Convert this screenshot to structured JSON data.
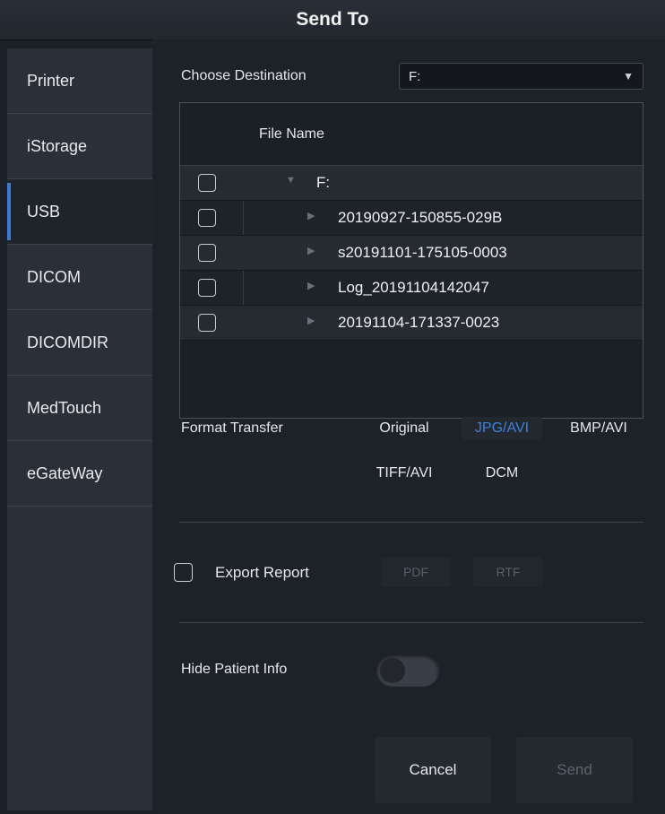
{
  "dialog": {
    "title": "Send To"
  },
  "sidebar": {
    "items": [
      {
        "label": "Printer"
      },
      {
        "label": "iStorage"
      },
      {
        "label": "USB"
      },
      {
        "label": "DICOM"
      },
      {
        "label": "DICOMDIR"
      },
      {
        "label": "MedTouch"
      },
      {
        "label": "eGateWay"
      }
    ],
    "active": "USB"
  },
  "destination": {
    "label": "Choose Destination",
    "value": "F:"
  },
  "file_table": {
    "header": "File Name",
    "rows": [
      {
        "name": "F:",
        "level": 0,
        "checked": false
      },
      {
        "name": "20190927-150855-029B",
        "level": 1,
        "checked": false
      },
      {
        "name": "s20191101-175105-0003",
        "level": 1,
        "checked": false
      },
      {
        "name": "Log_20191104142047",
        "level": 1,
        "checked": false
      },
      {
        "name": "20191104-171337-0023",
        "level": 1,
        "checked": false
      }
    ]
  },
  "format_transfer": {
    "label": "Format Transfer",
    "options": [
      "Original",
      "JPG/AVI",
      "BMP/AVI",
      "TIFF/AVI",
      "DCM"
    ],
    "selected": "JPG/AVI"
  },
  "export_report": {
    "label": "Export Report",
    "checked": false,
    "formats": [
      "PDF",
      "RTF"
    ]
  },
  "hide_patient_info": {
    "label": "Hide Patient Info",
    "enabled": false
  },
  "buttons": {
    "cancel": "Cancel",
    "send": "Send"
  },
  "colors": {
    "accent": "#3d82e0",
    "background": "#1d2128",
    "sidebar": "#2b3038"
  }
}
